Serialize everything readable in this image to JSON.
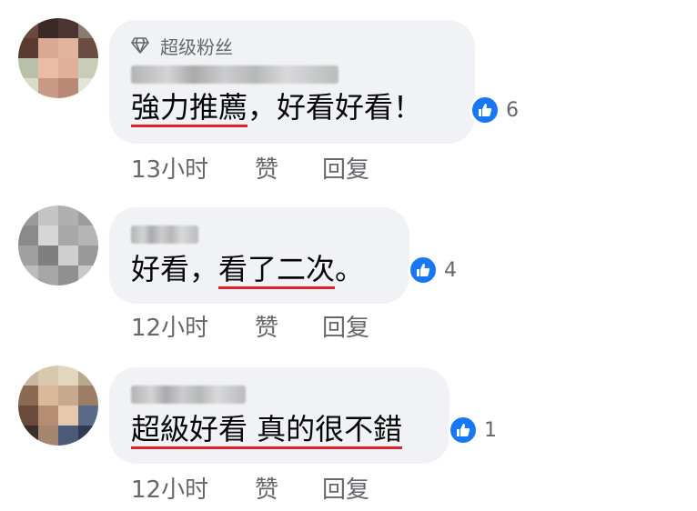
{
  "comments": [
    {
      "badge": "超级粉丝",
      "text_parts": [
        "強力推薦",
        "，好看好看！"
      ],
      "reaction_count": "6",
      "time": "13小时",
      "like_label": "赞",
      "reply_label": "回复"
    },
    {
      "text_parts": [
        "好看，",
        "看了二次",
        "。"
      ],
      "reaction_count": "4",
      "time": "12小时",
      "like_label": "赞",
      "reply_label": "回复"
    },
    {
      "text_parts": [
        "超級好看 真的很不錯"
      ],
      "reaction_count": "1",
      "time": "12小时",
      "like_label": "赞",
      "reply_label": "回复"
    }
  ],
  "colors": {
    "bubble_bg": "#f0f2f5",
    "like_blue": "#1877f2",
    "underline_red": "#e0202c",
    "meta_gray": "#65676b"
  },
  "icons": [
    "diamond-icon",
    "thumbs-up-icon"
  ]
}
